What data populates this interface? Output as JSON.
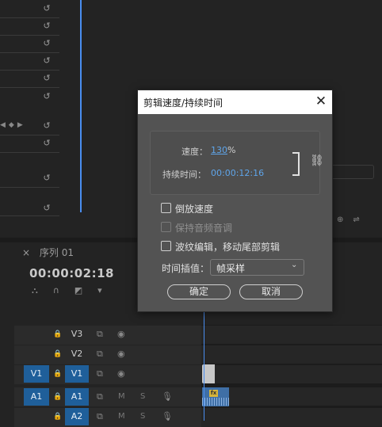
{
  "dialog": {
    "title": "剪辑速度/持续时间",
    "speed_label": "速度：",
    "speed_value": "130",
    "speed_unit": "%",
    "duration_label": "持续时间：",
    "duration_value": "00:00:12:16",
    "reverse_label": "倒放速度",
    "maintain_pitch_label": "保持音频音调",
    "ripple_label": "波纹编辑，移动尾部剪辑",
    "interp_label": "时间插值：",
    "interp_value": "帧采样",
    "ok_label": "确定",
    "cancel_label": "取消"
  },
  "timeline": {
    "tab_label": "序列 01",
    "tab_close": "×",
    "timecode": "00:00:02:18",
    "tracks": {
      "v3": "V3",
      "v2": "V2",
      "v1_src": "V1",
      "v1": "V1",
      "a1_src": "A1",
      "a1": "A1",
      "a2": "A2"
    },
    "m_label": "M",
    "s_label": "S",
    "fx_badge": "fx"
  },
  "colors": {
    "accent": "#4a8ef0",
    "track_active": "#1f5f9a",
    "value_blue": "#5fa5ea"
  },
  "icons": {
    "reset": "reset-parameter-icon",
    "lock": "lock-icon",
    "eye": "eye-icon",
    "link": "link-icon",
    "close": "close-icon"
  }
}
